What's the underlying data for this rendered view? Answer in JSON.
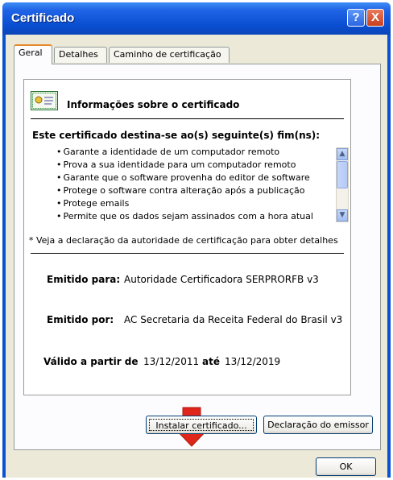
{
  "window": {
    "title": "Certificado"
  },
  "titlebar_buttons": {
    "help": "?",
    "close": "X"
  },
  "tabs": [
    {
      "label": "Geral"
    },
    {
      "label": "Detalhes"
    },
    {
      "label": "Caminho de certificação"
    }
  ],
  "cert": {
    "heading": "Informações sobre o certificado",
    "purpose_title": "Este certificado destina-se ao(s) seguinte(s) fim(ns):",
    "purposes": [
      "Garante a identidade de um computador remoto",
      "Prova a sua identidade para um computador remoto",
      "Garante que o software provenha do editor de software",
      "Protege o software contra alteração após a publicação",
      "Protege emails",
      "Permite que os dados sejam assinados com a hora atual"
    ],
    "note": "* Veja a declaração da autoridade de certificação para obter detalhes",
    "issued_to_label": "Emitido para:",
    "issued_to_value": "Autoridade Certificadora SERPRORFB v3",
    "issued_by_label": "Emitido por:",
    "issued_by_value": "AC Secretaria da Receita Federal do Brasil v3",
    "valid_from_label": "Válido a partir de",
    "valid_from_value": "13/12/2011",
    "valid_to_label": "até",
    "valid_to_value": "13/12/2019"
  },
  "buttons": {
    "install": "Instalar certificado...",
    "issuer_statement": "Declaração do emissor",
    "ok": "OK"
  },
  "colors": {
    "titlebar": "#0a52d0",
    "dialog_bg": "#ece9d8",
    "arrow": "#e0261b",
    "active_tab_accent": "#e68b2c"
  },
  "icons": {
    "certificate": "certificate-icon",
    "annotation": "down-arrow-icon"
  }
}
